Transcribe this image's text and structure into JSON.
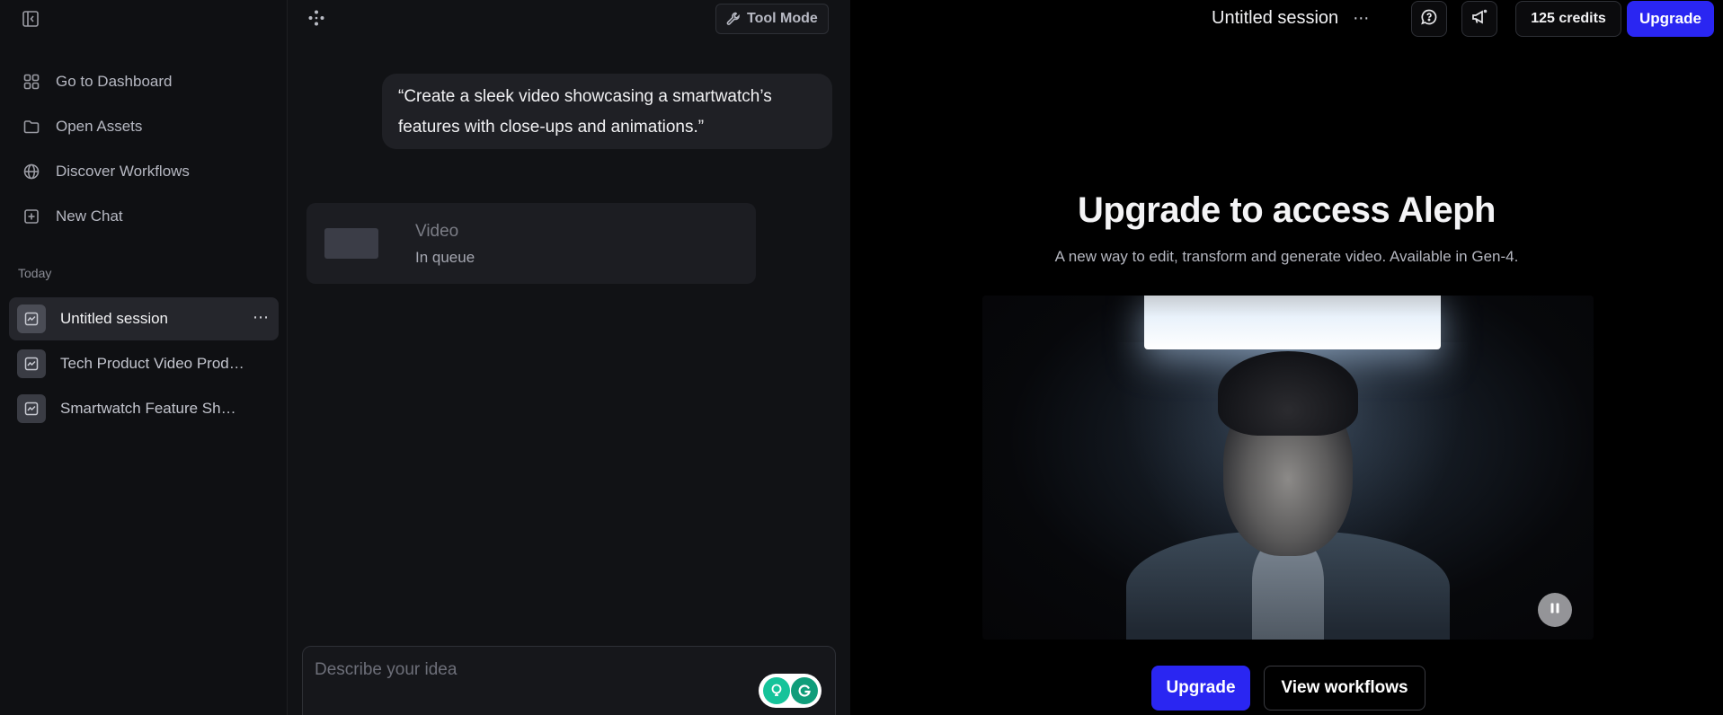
{
  "sidebar": {
    "toggle_icon": "sidebar-collapse-icon",
    "nav": [
      {
        "label": "Go to Dashboard",
        "icon": "dashboard-grid-icon"
      },
      {
        "label": "Open Assets",
        "icon": "folder-icon"
      },
      {
        "label": "Discover Workflows",
        "icon": "globe-icon"
      },
      {
        "label": "New Chat",
        "icon": "plus-square-icon"
      }
    ],
    "section_label": "Today",
    "sessions": [
      {
        "label": "Untitled session",
        "active": true
      },
      {
        "label": "Tech Product Video Prod…",
        "active": false
      },
      {
        "label": "Smartwatch Feature Sh…",
        "active": false
      }
    ],
    "session_more": "⋯"
  },
  "chat": {
    "tool_mode_label": "Tool Mode",
    "user_message": "“Create a sleek video showcasing a smartwatch’s features with close-ups and animations.”",
    "video_card": {
      "title": "Video",
      "status": "In queue"
    },
    "composer_placeholder": "Describe your idea"
  },
  "right": {
    "session_title": "Untitled session",
    "title_more": "⋯",
    "credits": "125 credits",
    "upgrade_top": "Upgrade",
    "hero_title": "Upgrade to access Aleph",
    "hero_subtitle": "A new way to edit, transform and generate video. Available in Gen-4.",
    "upgrade_button": "Upgrade",
    "workflows_button": "View workflows"
  },
  "colors": {
    "accent": "#2a26f2",
    "sidebar_bg": "#0f1013",
    "chat_bg": "#111215",
    "right_bg": "#000000"
  }
}
